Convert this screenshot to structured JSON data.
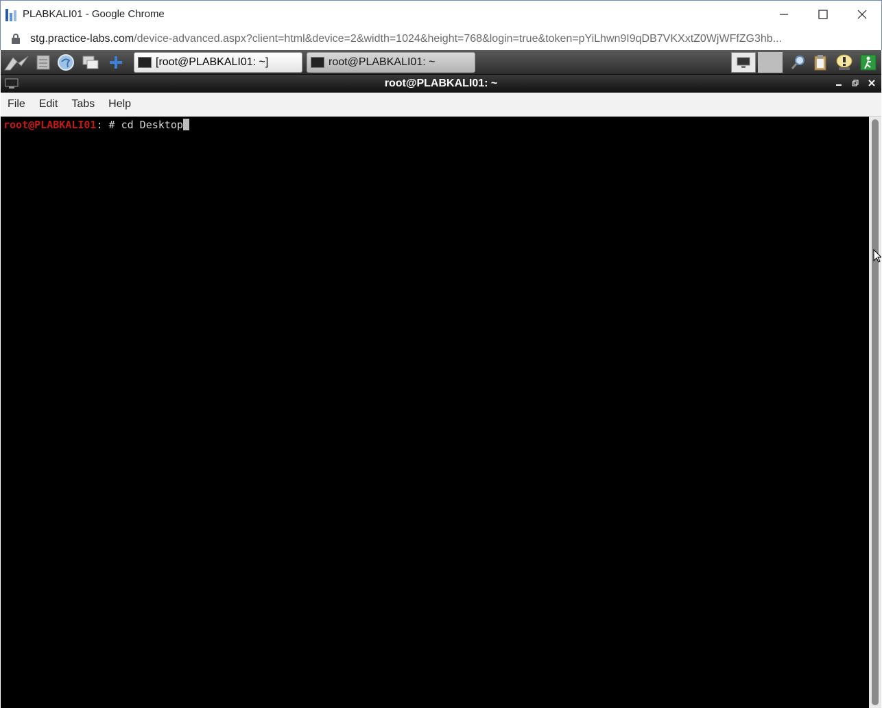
{
  "browser": {
    "window_title": "PLABKALI01 - Google Chrome",
    "url_host": "stg.practice-labs.com",
    "url_path": "/device-advanced.aspx?client=html&device=2&width=1024&height=768&login=true&token=pYiLhwn9I9qDB7VKXxtZ0WjWFfZG3hb..."
  },
  "panel": {
    "launchers": [
      "kali-menu-icon",
      "file-manager-icon",
      "browser-icon",
      "show-desktop-icon",
      "add-icon"
    ],
    "tasks": [
      {
        "label": "[root@PLABKALI01: ~]",
        "active": true
      },
      {
        "label": "root@PLABKALI01: ~",
        "active": false
      }
    ],
    "tray": [
      "display-icon",
      "workspace-icon",
      "search-icon",
      "clipboard-icon",
      "alert-icon",
      "logout-icon"
    ]
  },
  "terminal": {
    "window_title": "root@PLABKALI01: ~",
    "menus": [
      "File",
      "Edit",
      "Tabs",
      "Help"
    ],
    "prompt_user": "root@PLABKALI01",
    "prompt_rest": ": # ",
    "command": "cd Desktop"
  },
  "colors": {
    "prompt_red": "#c41a16",
    "terminal_bg": "#000000",
    "panel_dark": "#2e2e2e"
  }
}
